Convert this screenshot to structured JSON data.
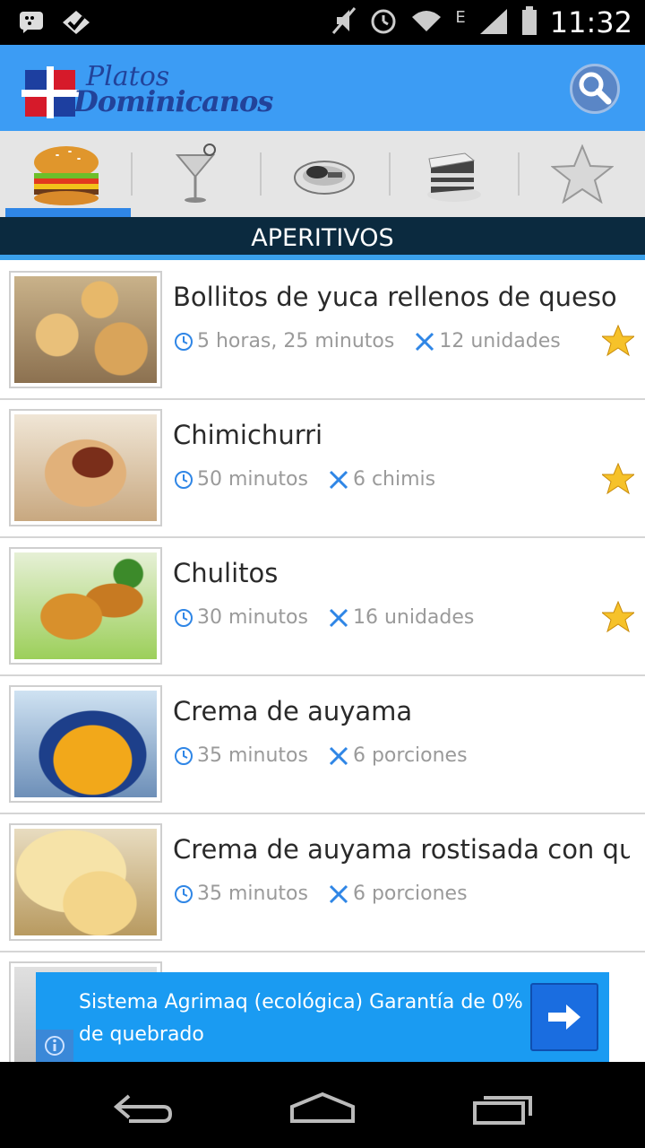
{
  "status_bar": {
    "time": "11:32",
    "network_label": "E"
  },
  "app": {
    "logo_line1": "Platos",
    "logo_line2": "Dominicanos"
  },
  "tabs": [
    {
      "icon": "burger-icon",
      "active": true
    },
    {
      "icon": "cocktail-icon",
      "active": false
    },
    {
      "icon": "main-dish-icon",
      "active": false
    },
    {
      "icon": "cake-icon",
      "active": false
    },
    {
      "icon": "star-icon",
      "active": false
    }
  ],
  "section_title": "APERITIVOS",
  "recipes": [
    {
      "title": "Bollitos de yuca rellenos de queso",
      "time": "5 horas, 25 minutos",
      "yield": "12 unidades",
      "favorite": true
    },
    {
      "title": "Chimichurri",
      "time": "50 minutos",
      "yield": "6 chimis",
      "favorite": true
    },
    {
      "title": "Chulitos",
      "time": "30 minutos",
      "yield": "16 unidades",
      "favorite": true
    },
    {
      "title": "Crema de auyama",
      "time": "35 minutos",
      "yield": "6 porciones",
      "favorite": false
    },
    {
      "title": "Crema de auyama rostisada con queso",
      "time": "35 minutos",
      "yield": "6 porciones",
      "favorite": false
    }
  ],
  "ad": {
    "text": "Sistema Agrimaq (ecológica) Garantía de 0% de quebrado"
  },
  "colors": {
    "app_bar": "#3c9cf4",
    "section_bar": "#0b2a3f",
    "accent": "#2f86e6",
    "meta_icon": "#2f86e6",
    "ad_bg": "#1a9bf2"
  }
}
